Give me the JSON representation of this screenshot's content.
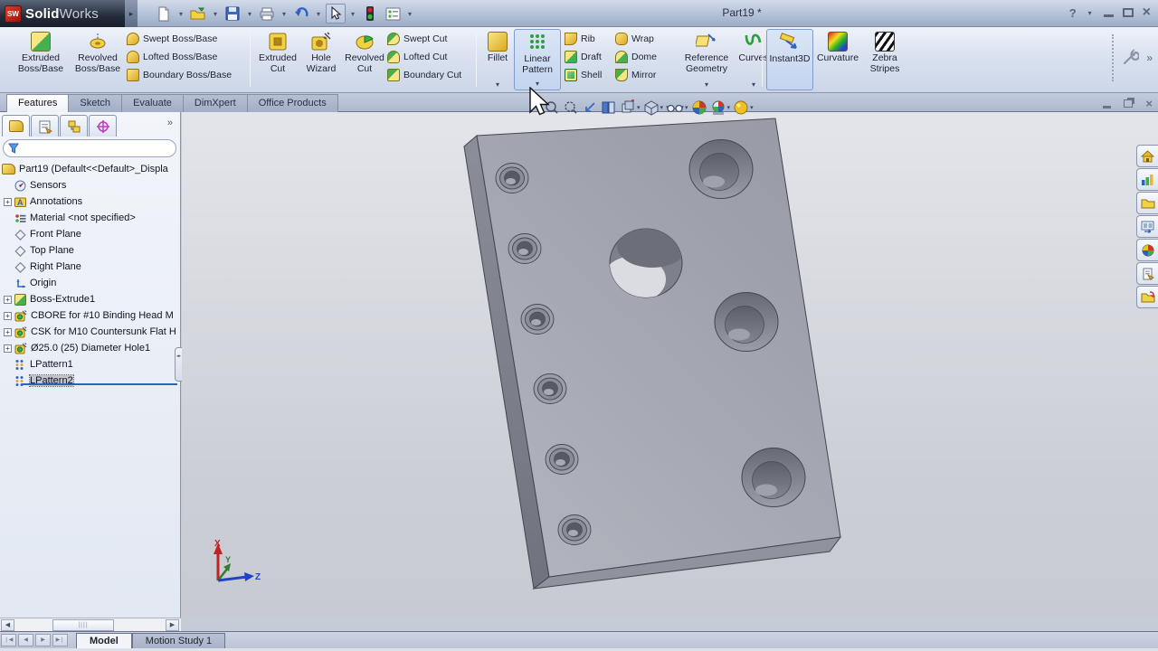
{
  "titlebar": {
    "logo_bold": "Solid",
    "logo_light": "Works",
    "logo_cube": "SW",
    "document_title": "Part19 *",
    "help_label": "?"
  },
  "quick_toolbar": {
    "icons": [
      "new-document",
      "open",
      "save",
      "print",
      "undo",
      "select",
      "rebuild-traffic-light",
      "options-checklist"
    ]
  },
  "ribbon": {
    "boss": {
      "big": [
        "Extruded Boss/Base",
        "Revolved Boss/Base"
      ],
      "stack": [
        "Swept Boss/Base",
        "Lofted Boss/Base",
        "Boundary Boss/Base"
      ]
    },
    "cut": {
      "big": [
        "Extruded Cut",
        "Hole Wizard",
        "Revolved Cut"
      ],
      "stack": [
        "Swept Cut",
        "Lofted Cut",
        "Boundary Cut"
      ]
    },
    "features": {
      "fillet": "Fillet",
      "linear_pattern": "Linear Pattern",
      "stack1": [
        "Rib",
        "Draft",
        "Shell"
      ],
      "stack2": [
        "Wrap",
        "Dome",
        "Mirror"
      ],
      "reference_geometry": "Reference Geometry",
      "curves": "Curves"
    },
    "view": {
      "big": [
        "Instant3D",
        "Curvature",
        "Zebra Stripes"
      ]
    }
  },
  "mode_tabs": [
    "Features",
    "Sketch",
    "Evaluate",
    "DimXpert",
    "Office Products"
  ],
  "feature_tree": {
    "root": "Part19  (Default<<Default>_Displa",
    "items": [
      {
        "label": "Sensors"
      },
      {
        "label": "Annotations",
        "expandable": true
      },
      {
        "label": "Material <not specified>"
      },
      {
        "label": "Front Plane"
      },
      {
        "label": "Top Plane"
      },
      {
        "label": "Right Plane"
      },
      {
        "label": "Origin"
      },
      {
        "label": "Boss-Extrude1",
        "expandable": true
      },
      {
        "label": "CBORE for #10 Binding Head M",
        "expandable": true
      },
      {
        "label": "CSK for M10 Countersunk Flat H",
        "expandable": true
      },
      {
        "label": "Ø25.0 (25) Diameter Hole1",
        "expandable": true
      },
      {
        "label": "LPattern1"
      },
      {
        "label": "LPattern2",
        "selected": true
      }
    ]
  },
  "viewport": {
    "triad": {
      "x": "X",
      "y": "Y",
      "z": "Z"
    }
  },
  "hud_icons": [
    "zoom-to-fit",
    "zoom-to-area",
    "previous-view",
    "section-view",
    "view-orientation",
    "display-style",
    "hide-show-items",
    "edit-appearance",
    "apply-scene",
    "view-settings"
  ],
  "task_pane_icons": [
    "solidworks-resources",
    "design-library",
    "file-explorer",
    "view-palette",
    "appearances-scenes",
    "custom-properties",
    "document-recovery"
  ],
  "bottom_bar": {
    "tabs": [
      "Model",
      "Motion Study 1"
    ]
  },
  "glyphs": {
    "dropdown": "▾",
    "chevron_right": "»",
    "overflow_arrow": "▸",
    "expand": "+",
    "scroll_left": "◀",
    "scroll_right": "▶",
    "nav_first": "❘◀",
    "nav_prev": "◀",
    "nav_next": "▶",
    "nav_last": "▶❘",
    "grip": "||||"
  },
  "colors": {
    "selection_blue": "#2f62c0",
    "part_gray": "#a4a6b1",
    "highlight_border": "#7e9ccc"
  }
}
